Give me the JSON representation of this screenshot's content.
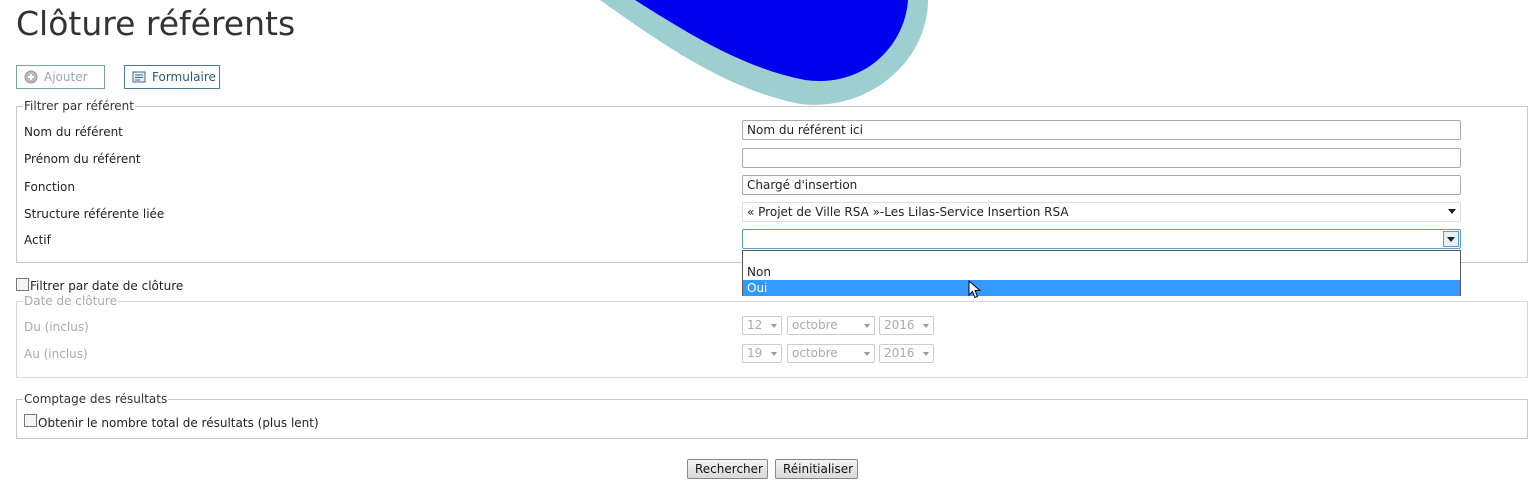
{
  "page": {
    "title": "Clôture référents"
  },
  "actions": {
    "add_label": "Ajouter",
    "form_label": "Formulaire"
  },
  "filter_referent": {
    "legend": "Filtrer par référent",
    "fields": {
      "nom": {
        "label": "Nom du référent",
        "value": "Nom du référent ici"
      },
      "prenom": {
        "label": "Prénom du référent",
        "value": ""
      },
      "fonction": {
        "label": "Fonction",
        "value": "Chargé d'insertion"
      },
      "structure": {
        "label": "Structure référente liée",
        "value": "« Projet de Ville RSA »-Les Lilas-Service Insertion RSA"
      },
      "actif": {
        "label": "Actif",
        "value": "",
        "options": [
          "",
          "Non",
          "Oui"
        ],
        "highlighted": "Oui"
      }
    }
  },
  "filter_date": {
    "checkbox_label": "Filtrer par date de clôture",
    "checked": false,
    "legend": "Date de clôture",
    "from": {
      "label": "Du (inclus)",
      "day": "12",
      "month": "octobre",
      "year": "2016"
    },
    "to": {
      "label": "Au (inclus)",
      "day": "19",
      "month": "octobre",
      "year": "2016"
    }
  },
  "count": {
    "legend": "Comptage des résultats",
    "checkbox_label": "Obtenir le nombre total de résultats (plus lent)",
    "checked": false
  },
  "buttons": {
    "search": "Rechercher",
    "reset": "Réinitialiser"
  },
  "colors": {
    "highlight": "#3399ff",
    "deco_fill": "#0000ee",
    "deco_ring": "#9ecfd0"
  }
}
